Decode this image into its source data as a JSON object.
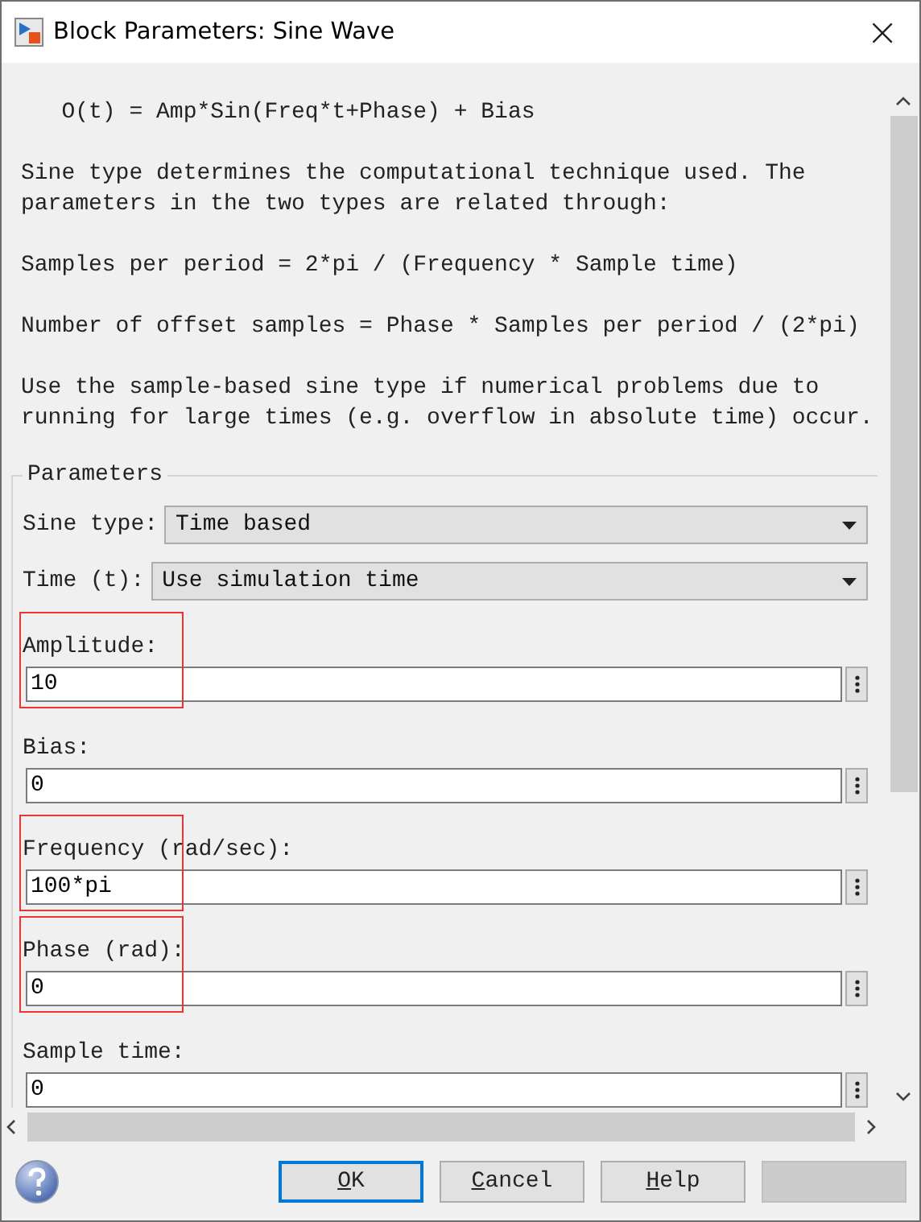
{
  "window": {
    "title": "Block Parameters: Sine Wave",
    "close": "×"
  },
  "description": [
    {
      "text": "   O(t) = Amp*Sin(Freq*t+Phase) + Bias"
    },
    {
      "text": "Sine type determines the computational technique used. The\nparameters in the two types are related through:"
    },
    {
      "text": "Samples per period = 2*pi / (Frequency * Sample time)"
    },
    {
      "text": "Number of offset samples = Phase * Samples per period / (2*pi)"
    },
    {
      "text": "Use the sample-based sine type if numerical problems due to\nrunning for large times (e.g. overflow in absolute time) occur."
    }
  ],
  "parameters": {
    "title": "Parameters",
    "dropdowns": [
      {
        "label": "Sine type:",
        "value": "Time based"
      },
      {
        "label": "Time (t):",
        "value": "Use simulation time"
      }
    ],
    "fields": [
      {
        "label": "Amplitude:",
        "value": "10",
        "highlighted": true
      },
      {
        "label": "Bias:",
        "value": "0",
        "highlighted": false
      },
      {
        "label": "Frequency (rad/sec):",
        "value": "100*pi",
        "highlighted": true
      },
      {
        "label": "Phase (rad):",
        "value": "0",
        "highlighted": true
      },
      {
        "label": "Sample time:",
        "value": "0",
        "highlighted": false
      }
    ]
  },
  "buttons": [
    {
      "key": "O",
      "rest": "K",
      "focused": true,
      "disabled": false
    },
    {
      "key": "C",
      "rest": "ancel",
      "focused": false,
      "disabled": false
    },
    {
      "key": "H",
      "rest": "elp",
      "focused": false,
      "disabled": false
    },
    {
      "focused": false,
      "disabled": true
    }
  ]
}
